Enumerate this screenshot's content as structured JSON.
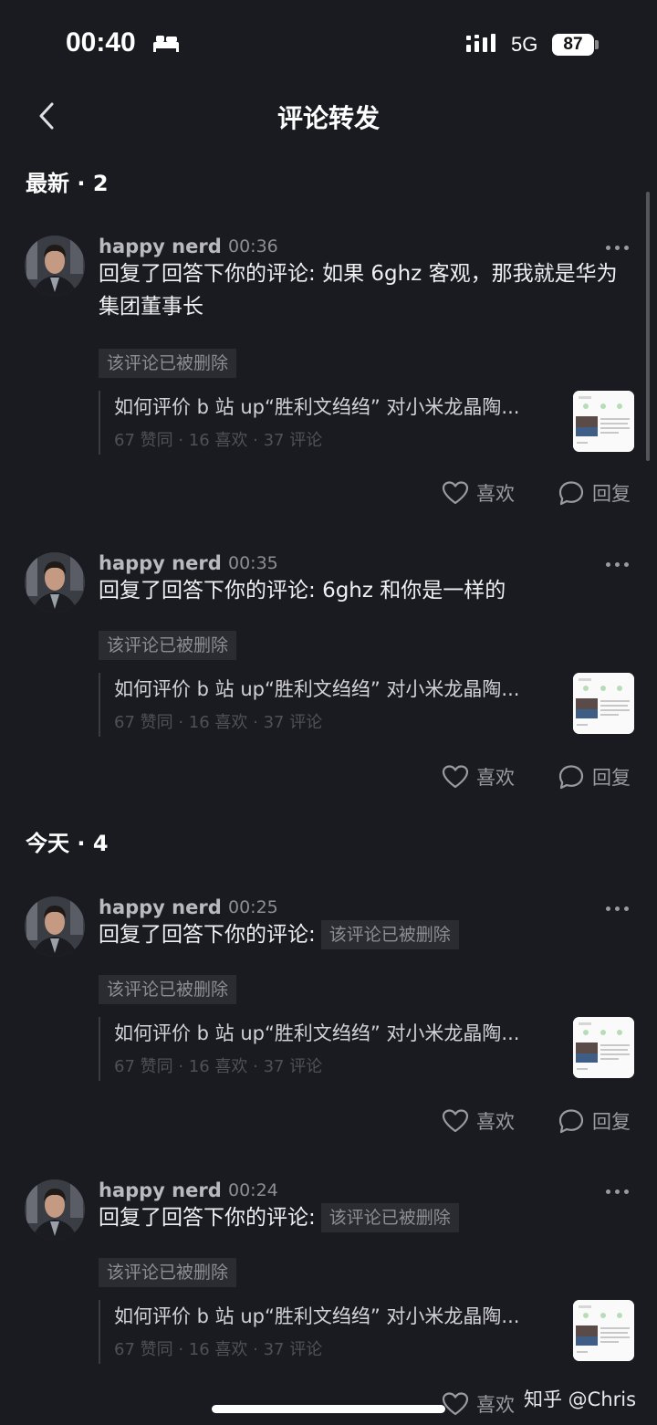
{
  "status_bar": {
    "time": "00:40",
    "network": "5G",
    "battery": "87"
  },
  "header": {
    "title": "评论转发"
  },
  "sections": [
    {
      "label": "最新 · 2"
    },
    {
      "label": "今天 · 4"
    }
  ],
  "comments": [
    {
      "author": "happy nerd",
      "time": "00:36",
      "prefix": "回复了回答下你的评论: ",
      "body": "如果 6ghz 客观，那我就是华为集团董事长",
      "inline_tag": "",
      "deleted_tag": "该评论已被删除",
      "quote_title": "如何评价 b 站 up“胜利文绉绉” 对小米龙晶陶...",
      "quote_stats": "67 赞同 · 16 喜欢 · 37 评论",
      "like": "喜欢",
      "reply": "回复"
    },
    {
      "author": "happy nerd",
      "time": "00:35",
      "prefix": "回复了回答下你的评论: ",
      "body": "6ghz 和你是一样的",
      "inline_tag": "",
      "deleted_tag": "该评论已被删除",
      "quote_title": "如何评价 b 站 up“胜利文绉绉” 对小米龙晶陶...",
      "quote_stats": "67 赞同 · 16 喜欢 · 37 评论",
      "like": "喜欢",
      "reply": "回复"
    },
    {
      "author": "happy nerd",
      "time": "00:25",
      "prefix": "回复了回答下你的评论:",
      "body": "",
      "inline_tag": "该评论已被删除",
      "deleted_tag": "该评论已被删除",
      "quote_title": "如何评价 b 站 up“胜利文绉绉” 对小米龙晶陶...",
      "quote_stats": "67 赞同 · 16 喜欢 · 37 评论",
      "like": "喜欢",
      "reply": "回复"
    },
    {
      "author": "happy nerd",
      "time": "00:24",
      "prefix": "回复了回答下你的评论:",
      "body": "",
      "inline_tag": "该评论已被删除",
      "deleted_tag": "该评论已被删除",
      "quote_title": "如何评价 b 站 up“胜利文绉绉” 对小米龙晶陶...",
      "quote_stats": "67 赞同 · 16 喜欢 · 37 评论",
      "like": "喜欢",
      "reply": ""
    }
  ],
  "watermark": "知乎 @Chris",
  "icons": {
    "back": "chevron-left-icon",
    "more": "more-horizontal-icon",
    "like": "heart-outline-icon",
    "reply": "chat-bubble-icon",
    "sleep": "bed-icon",
    "signal": "signal-bars-icon"
  },
  "colors": {
    "background": "#1a1b20",
    "text": "#f0f0f2",
    "muted": "#9a9aa0",
    "tag_bg": "#2b2c31"
  }
}
